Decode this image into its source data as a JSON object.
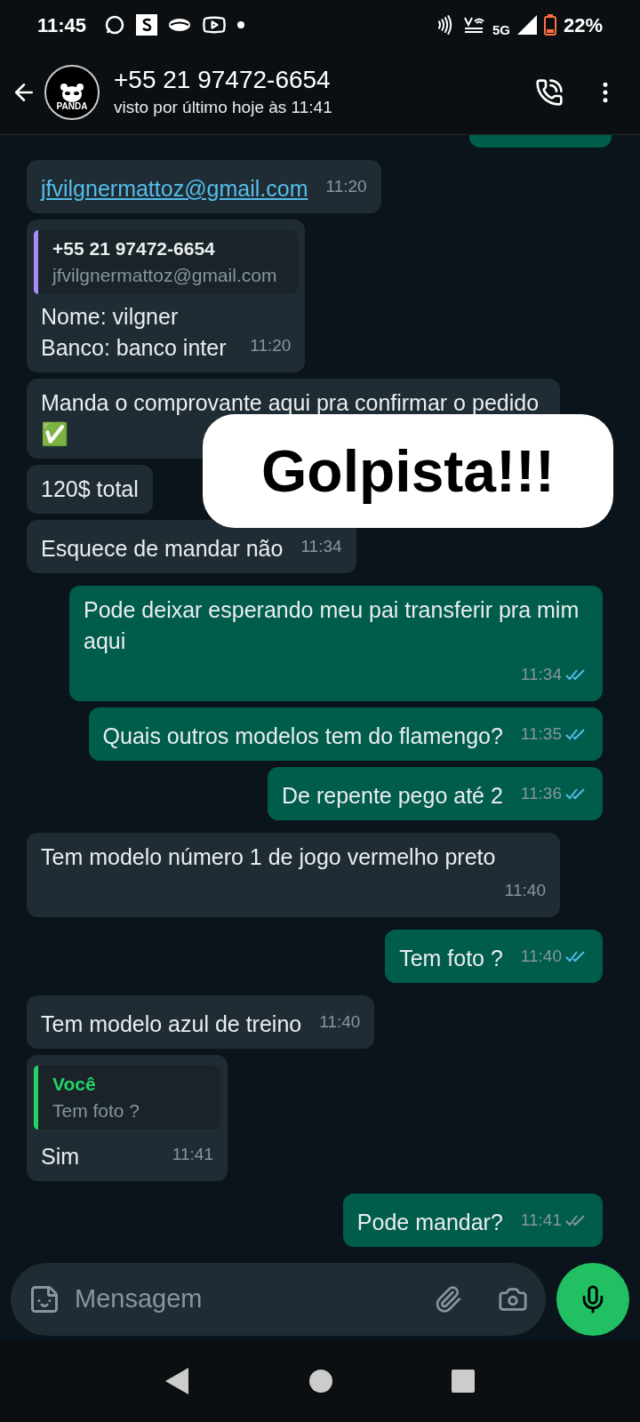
{
  "status_bar": {
    "time": "11:45",
    "network": "5G",
    "battery": "22%"
  },
  "header": {
    "avatar_label": "PANDA",
    "title": "+55 21 97472-6654",
    "subtitle": "visto por último hoje às 11:41"
  },
  "messages": [
    {
      "kind": "partial",
      "outgoing": true
    },
    {
      "kind": "link",
      "outgoing": false,
      "text": "jfvilgnermattoz@gmail.com",
      "time": "11:20"
    },
    {
      "kind": "reply",
      "outgoing": false,
      "quote": {
        "author": "+55 21 97472-6654",
        "text": "jfvilgnermattoz@gmail.com",
        "outgoing": false,
        "color": "#a78bfa"
      },
      "text": "Nome: vilgner\nBanco: banco inter",
      "time": "11:20"
    },
    {
      "kind": "text",
      "outgoing": false,
      "text": "Manda o comprovante aqui pra confirmar o pedido ✅"
    },
    {
      "kind": "text",
      "outgoing": false,
      "text": "120$ total"
    },
    {
      "kind": "text",
      "outgoing": false,
      "text": "Esquece de mandar não",
      "time": "11:34"
    },
    {
      "kind": "text",
      "outgoing": true,
      "text": "Pode deixar esperando meu pai transferir pra mim aqui",
      "time": "11:34",
      "read": true
    },
    {
      "kind": "text",
      "outgoing": true,
      "text": "Quais outros modelos tem do flamengo?",
      "time": "11:35",
      "read": true
    },
    {
      "kind": "text",
      "outgoing": true,
      "text": "De repente pego até 2",
      "time": "11:36",
      "read": true
    },
    {
      "kind": "text",
      "outgoing": false,
      "text": "Tem modelo número 1 de jogo vermelho preto",
      "time": "11:40"
    },
    {
      "kind": "text",
      "outgoing": true,
      "text": "Tem foto ?",
      "time": "11:40",
      "read": true
    },
    {
      "kind": "text",
      "outgoing": false,
      "text": "Tem modelo azul de treino",
      "time": "11:40"
    },
    {
      "kind": "reply",
      "outgoing": false,
      "quote": {
        "author": "Você",
        "text": "Tem foto ?",
        "outgoing": true,
        "color": "#25d366"
      },
      "text": "Sim",
      "time": "11:41"
    },
    {
      "kind": "text",
      "outgoing": true,
      "text": "Pode mandar?",
      "time": "11:41",
      "read": false
    }
  ],
  "overlay": {
    "text": "Golpista!!!"
  },
  "composer": {
    "placeholder": "Mensagem"
  }
}
